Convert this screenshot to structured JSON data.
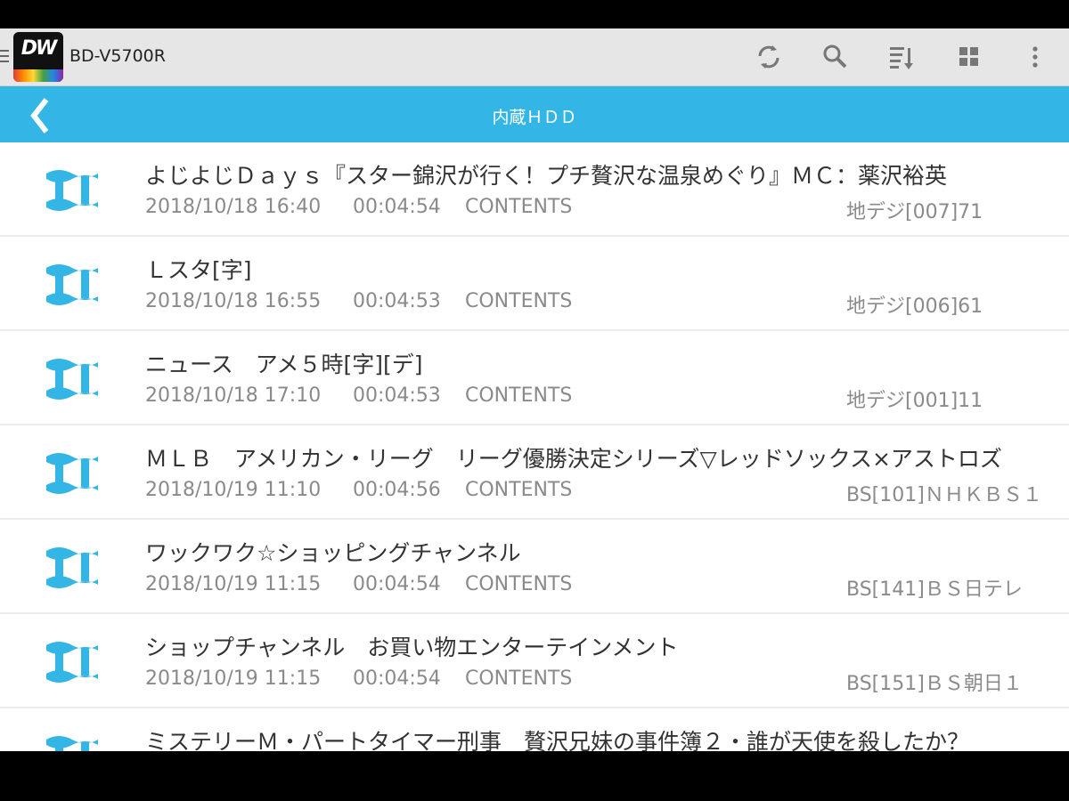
{
  "appbar": {
    "device_name": "BD-V5700R",
    "logo_text": "DW",
    "actions": [
      {
        "name": "refresh-icon"
      },
      {
        "name": "search-icon"
      },
      {
        "name": "sort-icon"
      },
      {
        "name": "grid-view-icon"
      },
      {
        "name": "overflow-menu-icon"
      }
    ]
  },
  "subbar": {
    "title": "内蔵ＨＤＤ",
    "back_icon": "chevron-left-icon"
  },
  "colors": {
    "accent": "#33b5e5",
    "appbar_bg": "#e6e6e6",
    "title_text": "#333333",
    "meta_text": "#8a8a8a"
  },
  "recordings": [
    {
      "title": "よじよじＤａｙｓ『スター錦沢が行く！プチ贅沢な温泉めぐり』ＭＣ：薬沢裕英",
      "date": "2018/10/18 16:40",
      "duration": "00:04:54",
      "type": "CONTENTS",
      "channel": "地デジ[007]71",
      "icon": "recording-icon"
    },
    {
      "title": "Ｌスタ[字]",
      "date": "2018/10/18 16:55",
      "duration": "00:04:53",
      "type": "CONTENTS",
      "channel": "地デジ[006]61",
      "icon": "recording-icon"
    },
    {
      "title": "ニュース　アメ５時[字][デ]",
      "date": "2018/10/18 17:10",
      "duration": "00:04:53",
      "type": "CONTENTS",
      "channel": "地デジ[001]11",
      "icon": "recording-icon"
    },
    {
      "title": "ＭＬＢ　アメリカン・リーグ　リーグ優勝決定シリーズ▽レッドソックス×アストロズ",
      "date": "2018/10/19 11:10",
      "duration": "00:04:56",
      "type": "CONTENTS",
      "channel": "BS[101]ＮＨＫＢＳ１",
      "icon": "recording-icon"
    },
    {
      "title": "ワックワク☆ショッピングチャンネル",
      "date": "2018/10/19 11:15",
      "duration": "00:04:54",
      "type": "CONTENTS",
      "channel": "BS[141]ＢＳ日テレ",
      "icon": "recording-icon"
    },
    {
      "title": "ショップチャンネル　お買い物エンターテインメント",
      "date": "2018/10/19 11:15",
      "duration": "00:04:54",
      "type": "CONTENTS",
      "channel": "BS[151]ＢＳ朝日１",
      "icon": "recording-icon"
    },
    {
      "title": "ミステリーＭ・パートタイマー刑事　贅沢兄妹の事件簿２・誰が天使を殺したか？",
      "date": "",
      "duration": "",
      "type": "",
      "channel": "",
      "icon": "recording-icon"
    }
  ]
}
